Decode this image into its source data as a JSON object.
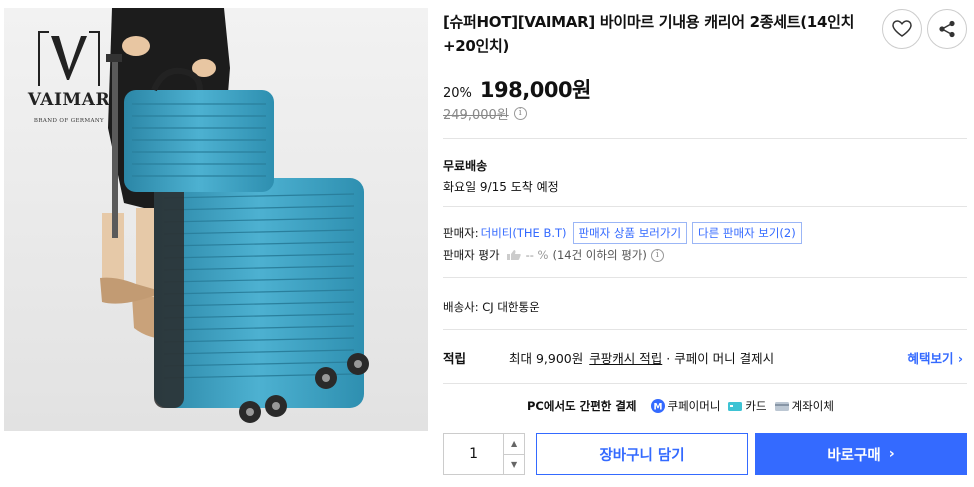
{
  "product": {
    "title": "[슈퍼HOT][VAIMAR] 바이마르 기내용 캐리어 2종세트(14인치+20인치)",
    "discount": "20%",
    "price": "198,000원",
    "original_price": "249,000원"
  },
  "logo": {
    "letter": "V",
    "brand": "VAIMAR",
    "tagline": "BRAND OF GERMANY"
  },
  "shipping": {
    "title": "무료배송",
    "arrival": "화요일 9/15 도착 예정",
    "carrier": "배송사:  CJ 대한통운"
  },
  "seller": {
    "label": "판매자:",
    "name": "더비티(THE B.T)",
    "view_products": "판매자 상품 보러가기",
    "other_sellers": "다른 판매자 보기(2)",
    "rating_label": "판매자 평가",
    "rating_value": "-- %",
    "rating_count": "(14건 이하의 평가)"
  },
  "reward": {
    "label": "적립",
    "text": "최대 9,900원",
    "link": "쿠팡캐시 적립",
    "rest": "· 쿠페이 머니 결제시",
    "more": "혜택보기 ›"
  },
  "payment": {
    "label": "PC에서도 간편한 결제",
    "methods": [
      "쿠페이머니",
      "카드",
      "계좌이체"
    ]
  },
  "purchase": {
    "quantity": "1",
    "cart": "장바구니 담기",
    "buy": "바로구매",
    "buy_chevron": "›"
  },
  "icons": {
    "favorite": "heart-icon",
    "share": "share-icon",
    "info": "info-icon",
    "thumb": "thumb-icon"
  },
  "colors": {
    "accent": "#346aff",
    "suitcase": "#3fa3c4"
  }
}
